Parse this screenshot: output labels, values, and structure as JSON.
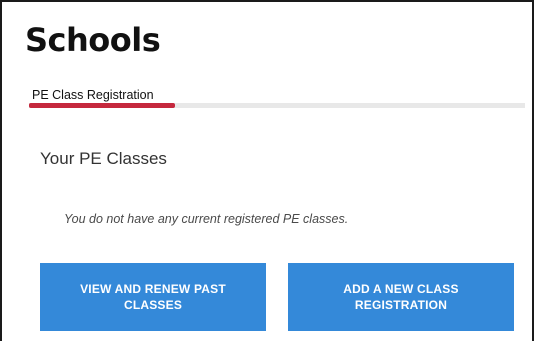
{
  "page": {
    "title": "Schools"
  },
  "tabs": [
    {
      "label": "PE Class Registration",
      "active": true
    }
  ],
  "section": {
    "title": "Your PE Classes",
    "empty_message": "You do not have any current registered PE classes."
  },
  "actions": {
    "view_renew_label": "VIEW AND RENEW PAST CLASSES",
    "add_new_label": "ADD A NEW CLASS REGISTRATION"
  },
  "colors": {
    "primary_button": "#3489d9",
    "active_tab_accent": "#c5283d",
    "tab_strip": "#e8e8e8"
  }
}
